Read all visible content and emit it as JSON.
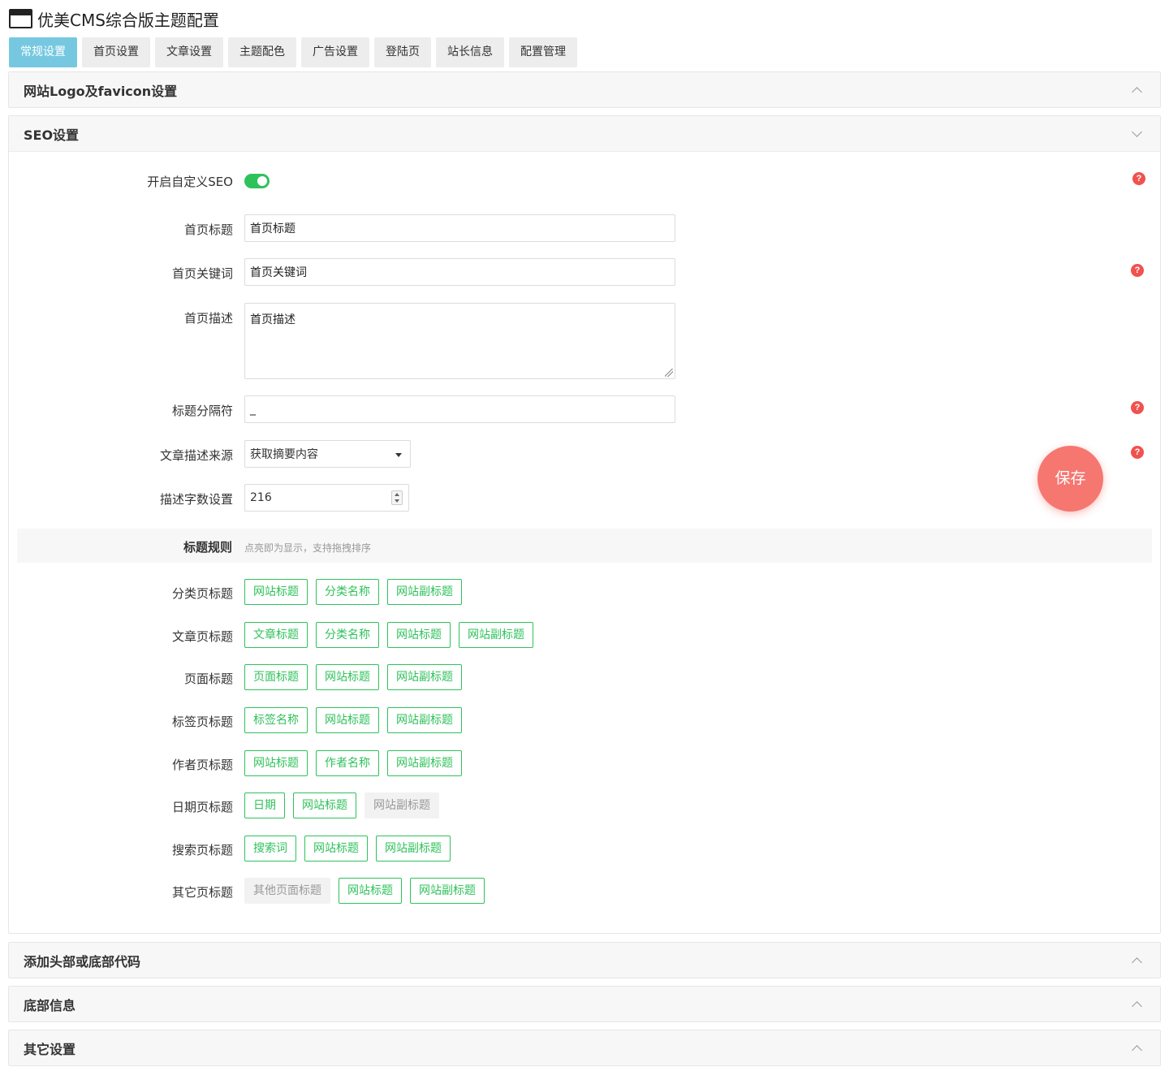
{
  "header": {
    "title": "优美CMS综合版主题配置",
    "icon": "browser-window-icon"
  },
  "tabs": [
    {
      "label": "常规设置",
      "active": true
    },
    {
      "label": "首页设置",
      "active": false
    },
    {
      "label": "文章设置",
      "active": false
    },
    {
      "label": "主题配色",
      "active": false
    },
    {
      "label": "广告设置",
      "active": false
    },
    {
      "label": "登陆页",
      "active": false
    },
    {
      "label": "站长信息",
      "active": false
    },
    {
      "label": "配置管理",
      "active": false
    }
  ],
  "panels": {
    "logo": {
      "title": "网站Logo及favicon设置",
      "expanded": false
    },
    "seo": {
      "title": "SEO设置",
      "expanded": true
    },
    "code": {
      "title": "添加头部或底部代码",
      "expanded": false
    },
    "footer": {
      "title": "底部信息",
      "expanded": false
    },
    "other": {
      "title": "其它设置",
      "expanded": false
    }
  },
  "seo": {
    "custom_seo": {
      "label": "开启自定义SEO",
      "enabled": true
    },
    "home_title": {
      "label": "首页标题",
      "value": "首页标题"
    },
    "home_keywords": {
      "label": "首页关键词",
      "value": "首页关键词"
    },
    "home_desc": {
      "label": "首页描述",
      "value": "首页描述"
    },
    "separator": {
      "label": "标题分隔符",
      "value": "_"
    },
    "desc_source": {
      "label": "文章描述来源",
      "value": "获取摘要内容"
    },
    "desc_length": {
      "label": "描述字数设置",
      "value": "216"
    },
    "rules": {
      "label": "标题规则",
      "hint": "点亮即为显示，支持拖拽排序"
    },
    "rule_rows": [
      {
        "label": "分类页标题",
        "chips": [
          {
            "text": "网站标题",
            "on": true
          },
          {
            "text": "分类名称",
            "on": true
          },
          {
            "text": "网站副标题",
            "on": true
          }
        ]
      },
      {
        "label": "文章页标题",
        "chips": [
          {
            "text": "文章标题",
            "on": true
          },
          {
            "text": "分类名称",
            "on": true
          },
          {
            "text": "网站标题",
            "on": true
          },
          {
            "text": "网站副标题",
            "on": true
          }
        ]
      },
      {
        "label": "页面标题",
        "chips": [
          {
            "text": "页面标题",
            "on": true
          },
          {
            "text": "网站标题",
            "on": true
          },
          {
            "text": "网站副标题",
            "on": true
          }
        ]
      },
      {
        "label": "标签页标题",
        "chips": [
          {
            "text": "标签名称",
            "on": true
          },
          {
            "text": "网站标题",
            "on": true
          },
          {
            "text": "网站副标题",
            "on": true
          }
        ]
      },
      {
        "label": "作者页标题",
        "chips": [
          {
            "text": "网站标题",
            "on": true
          },
          {
            "text": "作者名称",
            "on": true
          },
          {
            "text": "网站副标题",
            "on": true
          }
        ]
      },
      {
        "label": "日期页标题",
        "chips": [
          {
            "text": "日期",
            "on": true
          },
          {
            "text": "网站标题",
            "on": true
          },
          {
            "text": "网站副标题",
            "on": false
          }
        ]
      },
      {
        "label": "搜索页标题",
        "chips": [
          {
            "text": "搜索词",
            "on": true
          },
          {
            "text": "网站标题",
            "on": true
          },
          {
            "text": "网站副标题",
            "on": true
          }
        ]
      },
      {
        "label": "其它页标题",
        "chips": [
          {
            "text": "其他页面标题",
            "on": false
          },
          {
            "text": "网站标题",
            "on": true
          },
          {
            "text": "网站副标题",
            "on": true
          }
        ]
      }
    ]
  },
  "help_icon_text": "?",
  "save_label": "保存",
  "colors": {
    "accent": "#76c8e0",
    "green": "#2fc25b",
    "save": "#f57770",
    "help": "#f0524f"
  }
}
